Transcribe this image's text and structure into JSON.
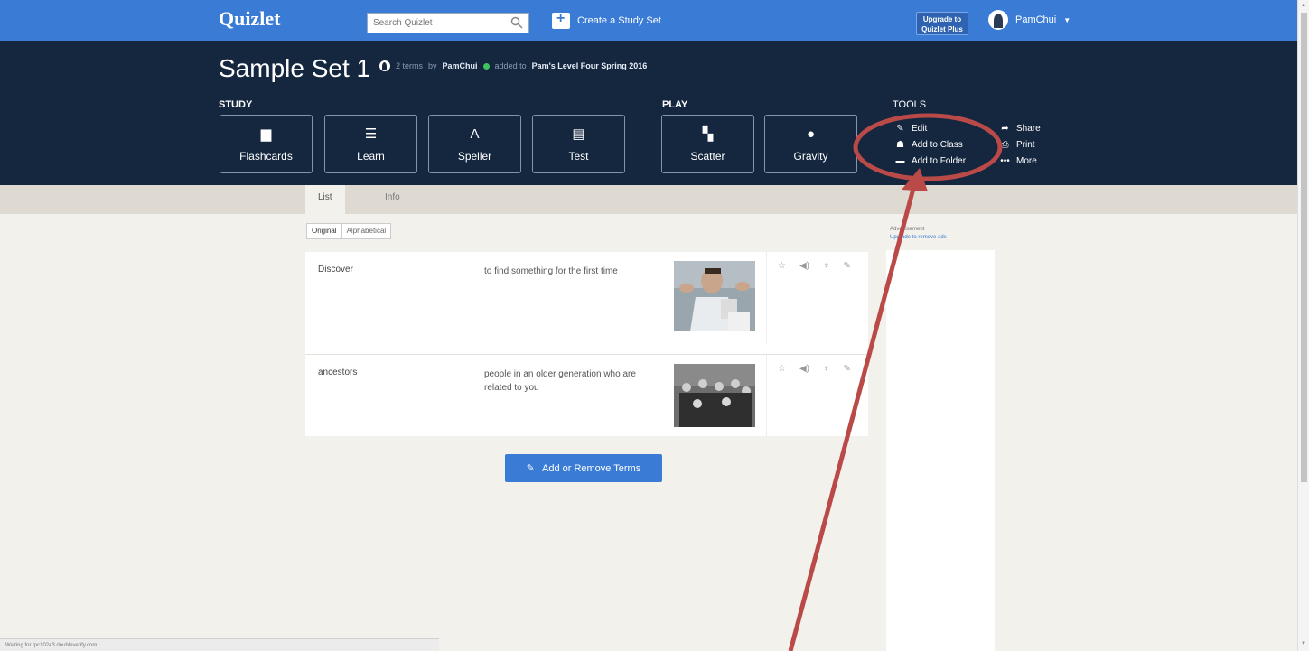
{
  "topbar": {
    "logo": "Quizlet",
    "search_placeholder": "Search Quizlet",
    "create_label": "Create a Study Set",
    "upgrade_line1": "Upgrade to",
    "upgrade_line2": "Quizlet Plus",
    "username": "PamChui"
  },
  "set": {
    "title": "Sample Set 1",
    "terms_count": "2 terms",
    "by_label": "by",
    "author": "PamChui",
    "added_to_label": "added to",
    "class_name": "Pam's Level Four Spring 2016"
  },
  "study": {
    "label": "STUDY",
    "modes": [
      {
        "label": "Flashcards",
        "icon": "flashcards-icon"
      },
      {
        "label": "Learn",
        "icon": "learn-icon"
      },
      {
        "label": "Speller",
        "icon": "speller-icon"
      },
      {
        "label": "Test",
        "icon": "test-icon"
      }
    ]
  },
  "play": {
    "label": "PLAY",
    "modes": [
      {
        "label": "Scatter",
        "icon": "scatter-icon"
      },
      {
        "label": "Gravity",
        "icon": "gravity-icon"
      }
    ]
  },
  "tools": {
    "label": "TOOLS",
    "items": [
      {
        "label": "Edit",
        "icon": "pencil-icon"
      },
      {
        "label": "Add to Class",
        "icon": "class-icon"
      },
      {
        "label": "Add to Folder",
        "icon": "folder-icon"
      },
      {
        "label": "Share",
        "icon": "share-icon"
      },
      {
        "label": "Print",
        "icon": "print-icon"
      },
      {
        "label": "More",
        "icon": "more-icon"
      }
    ]
  },
  "tabs": [
    "List",
    "Info"
  ],
  "sort": {
    "original": "Original",
    "alphabetical": "Alphabetical"
  },
  "terms": [
    {
      "word": "Discover",
      "definition": "to find something for the first time"
    },
    {
      "word": "ancestors",
      "definition": "people in an older generation who are related to you"
    }
  ],
  "add_button": "Add or Remove Terms",
  "ad": {
    "label": "Advertisement",
    "link": "Upgrade to remove ads"
  },
  "status_text": "Waiting for tpc10243.doubleverify.com...",
  "colors": {
    "brand_blue": "#3a7bd5",
    "header_navy": "#15263f",
    "annotation_red": "#b94a48"
  }
}
